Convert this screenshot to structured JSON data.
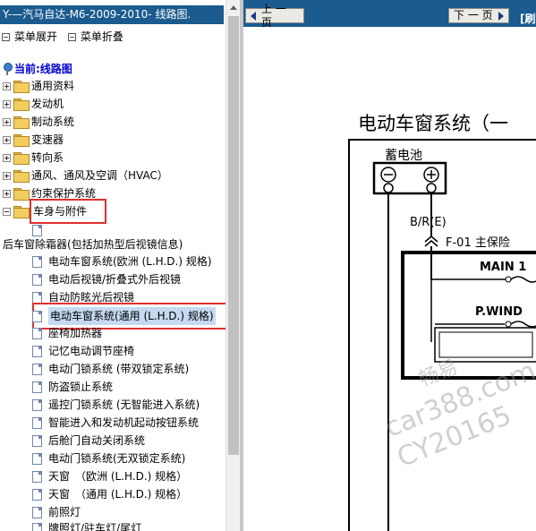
{
  "left_pane": {
    "title": "Y-—汽马自达-M6-2009-2010- 线路图.",
    "menu_expand": "菜单展开",
    "menu_collapse": "菜单折叠",
    "current": "当前:线路图",
    "categories": [
      "通用资料",
      "发动机",
      "制动系统",
      "变速器",
      "转向系",
      "通风、通风及空调（HVAC）",
      "约束保护系统",
      "车身与附件"
    ],
    "orphan_item": "后车窗除霜器(包括加热型后视镜信息)",
    "items": [
      "电动车窗系统(欧洲 (L.H.D.) 规格)",
      "电动后视镜/折叠式外后视镜",
      "自动防眩光后视镜",
      "电动车窗系统(通用 (L.H.D.) 规格)",
      "座椅加热器",
      "记忆电动调节座椅",
      "电动门锁系统 (带双锁定系统)",
      "防盗锁止系统",
      "遥控门锁系统 (无智能进入系统)",
      "智能进入和发动机起动按钮系统",
      "后舱门自动关闭系统",
      "电动门锁系统(无双锁定系统)",
      "天窗　（欧洲 (L.H.D.) 规格）",
      "天窗　（通用 (L.H.D.) 规格）",
      "前照灯",
      "牌照灯/驻车灯/尾灯"
    ]
  },
  "toolbar": {
    "prev_label": "上 一 页",
    "next_label": "下 一 页",
    "refresh_label": "[刷"
  },
  "diagram": {
    "title": "电动车窗系统（一",
    "battery_label": "蓄电池",
    "wire_label": "B/R(E)",
    "fuse_box_label": "F-01  主保险",
    "fuse_main": "MAIN 1",
    "fuse_pwind": "P.WIND"
  },
  "watermark": {
    "line1": "畅易",
    "line2": "car388.com",
    "line3": "CY20165"
  },
  "colors": {
    "title_bar": "#1b5b8f",
    "current_text": "#0000cc",
    "highlight_box": "#e03030",
    "selection": "#c5d9f1"
  }
}
